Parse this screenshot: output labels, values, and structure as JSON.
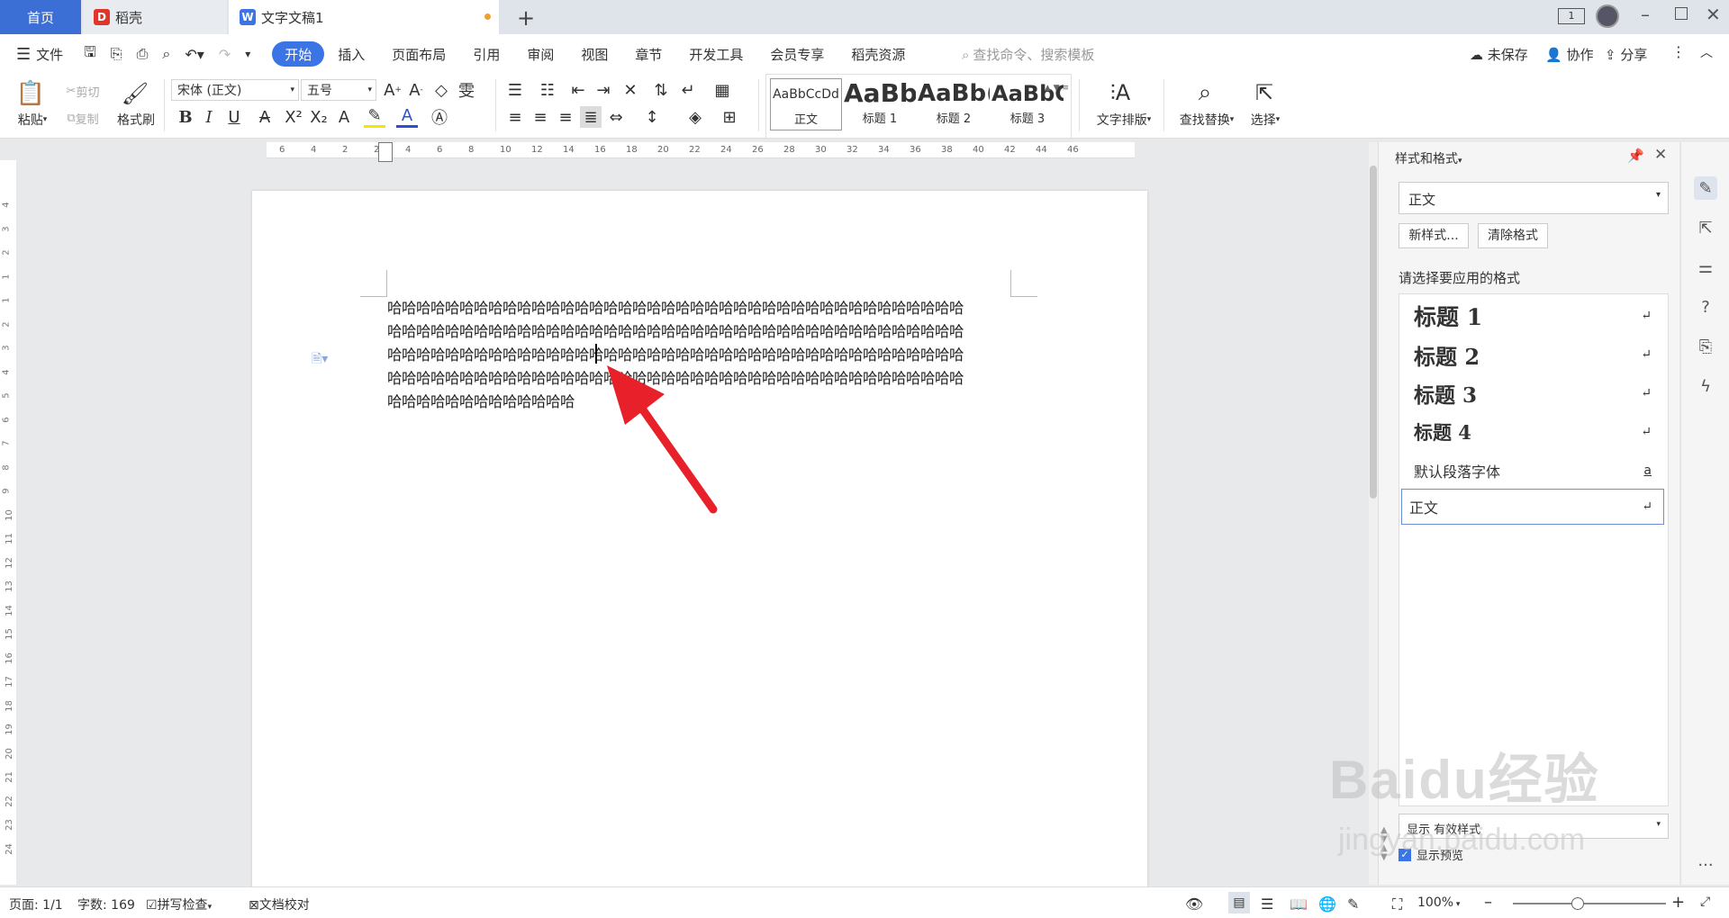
{
  "tabs": {
    "home": "首页",
    "daoke": "稻壳",
    "doc": "文字文稿1"
  },
  "titlebar": {
    "page_indicator": "1"
  },
  "menu": {
    "file": "文件",
    "items": [
      "开始",
      "插入",
      "页面布局",
      "引用",
      "审阅",
      "视图",
      "章节",
      "开发工具",
      "会员专享",
      "稻壳资源"
    ],
    "search_placeholder": "查找命令、搜索模板",
    "unsaved": "未保存",
    "collab": "协作",
    "share": "分享"
  },
  "ribbon": {
    "paste": "粘贴",
    "cut": "剪切",
    "copy": "复制",
    "format_painter": "格式刷",
    "font_name": "宋体 (正文)",
    "font_size": "五号",
    "styles": [
      {
        "preview": "AaBbCcDd",
        "label": "正文"
      },
      {
        "preview": "AaBb",
        "label": "标题 1"
      },
      {
        "preview": "AaBb(",
        "label": "标题 2"
      },
      {
        "preview": "AaBbC",
        "label": "标题 3"
      }
    ],
    "text_layout": "文字排版",
    "find_replace": "查找替换",
    "select": "选择"
  },
  "ruler": {
    "h_ticks": [
      "6",
      "4",
      "2",
      "2",
      "4",
      "6",
      "8",
      "10",
      "12",
      "14",
      "16",
      "18",
      "20",
      "22",
      "24",
      "26",
      "28",
      "30",
      "32",
      "34",
      "36",
      "38",
      "40",
      "42",
      "44",
      "46"
    ],
    "v_ticks": [
      "4",
      "3",
      "2",
      "1",
      "1",
      "2",
      "3",
      "4",
      "5",
      "6",
      "7",
      "8",
      "9",
      "10",
      "11",
      "12",
      "13",
      "14",
      "15",
      "16",
      "17",
      "18",
      "19",
      "20",
      "21",
      "22",
      "23",
      "24"
    ]
  },
  "document": {
    "lines": [
      "哈哈哈哈哈哈哈哈哈哈哈哈哈哈哈哈哈哈哈哈哈哈哈哈哈哈哈哈哈哈哈哈哈哈哈哈哈哈哈哈",
      "哈哈哈哈哈哈哈哈哈哈哈哈哈哈哈哈哈哈哈哈哈哈哈哈哈哈哈哈哈哈哈哈哈哈哈哈哈哈哈哈",
      "哈哈哈哈哈哈哈哈哈哈哈哈哈哈哈哈哈哈哈哈哈哈哈哈哈哈哈哈哈哈哈哈哈哈哈哈哈哈哈哈",
      "哈哈哈哈哈哈哈哈哈哈哈哈哈哈哈哈哈哈哈哈哈哈哈哈哈哈哈哈哈哈哈哈哈哈哈哈哈哈哈哈",
      "哈哈哈哈哈哈哈哈哈哈哈哈哈"
    ]
  },
  "pane": {
    "title": "样式和格式",
    "current": "正文",
    "new_style": "新样式...",
    "clear_format": "清除格式",
    "prompt": "请选择要应用的格式",
    "styles": [
      "标题 1",
      "标题 2",
      "标题 3",
      "标题 4",
      "默认段落字体",
      "正文"
    ],
    "show_label": "显示",
    "show_value": "有效样式",
    "preview_label": "显示预览"
  },
  "status": {
    "page": "页面: 1/1",
    "words": "字数: 169",
    "spell": "拼写检查",
    "proof": "文档校对",
    "zoom": "100%"
  },
  "watermark": {
    "brand": "Baidu经验",
    "url": "jingyan.baidu.com"
  },
  "colors": {
    "accent": "#3b74e4",
    "arrow": "#e8202a"
  }
}
